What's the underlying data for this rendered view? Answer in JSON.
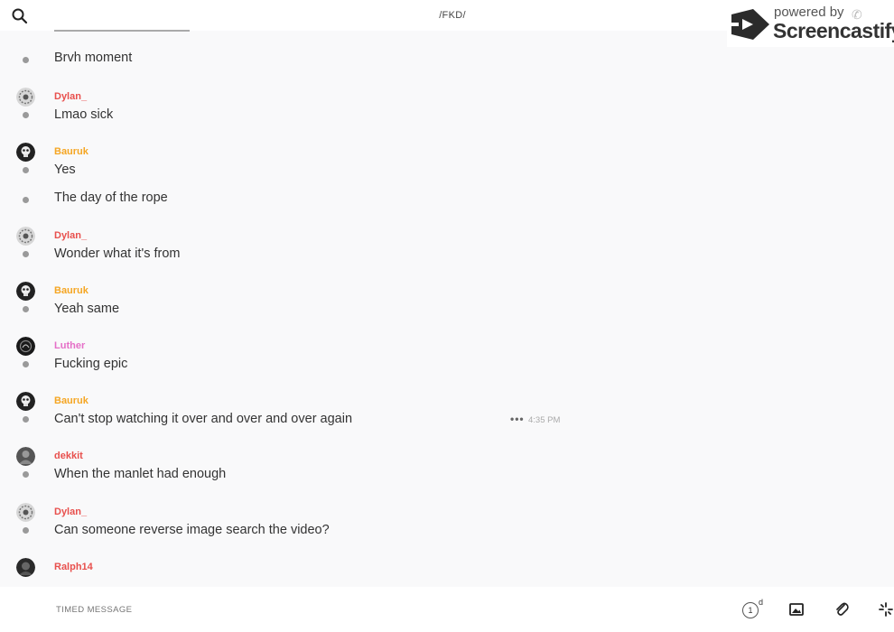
{
  "header": {
    "channel_title": "/FKD/",
    "search_icon": "search-icon"
  },
  "watermark": {
    "powered": "powered by",
    "brand": "Screencastify"
  },
  "messages": [
    {
      "author": "",
      "author_color": "",
      "avatar": "",
      "text": "Brvh moment"
    },
    {
      "author": "Dylan_",
      "author_color": "#e8504d",
      "avatar": "swirl",
      "text": "Lmao sick"
    },
    {
      "author": "Bauruk",
      "author_color": "#f5a623",
      "avatar": "skull",
      "text": "Yes"
    },
    {
      "author": "",
      "author_color": "",
      "avatar": "",
      "text": "The day of the rope"
    },
    {
      "author": "Dylan_",
      "author_color": "#e8504d",
      "avatar": "swirl",
      "text": "Wonder what it's from"
    },
    {
      "author": "Bauruk",
      "author_color": "#f5a623",
      "avatar": "skull",
      "text": "Yeah same"
    },
    {
      "author": "Luther",
      "author_color": "#e56fc7",
      "avatar": "dark",
      "text": "Fucking epic"
    },
    {
      "author": "Bauruk",
      "author_color": "#f5a623",
      "avatar": "skull",
      "text": "Can't stop watching it over and over and over again",
      "more": "•••",
      "time": "4:35 PM"
    },
    {
      "author": "dekkit",
      "author_color": "#e8504d",
      "avatar": "photo",
      "text": "When the manlet had enough"
    },
    {
      "author": "Dylan_",
      "author_color": "#e8504d",
      "avatar": "swirl",
      "text": "Can someone reverse image search the video?"
    },
    {
      "author": "Ralph14",
      "author_color": "#e8504d",
      "avatar": "dark2",
      "text": ""
    }
  ],
  "composer": {
    "placeholder": "TIMED MESSAGE",
    "timer_value": "1",
    "timer_unit": "d",
    "image_icon": "image-icon",
    "attach_icon": "paperclip-icon",
    "sparkle_icon": "sparkle-icon"
  }
}
